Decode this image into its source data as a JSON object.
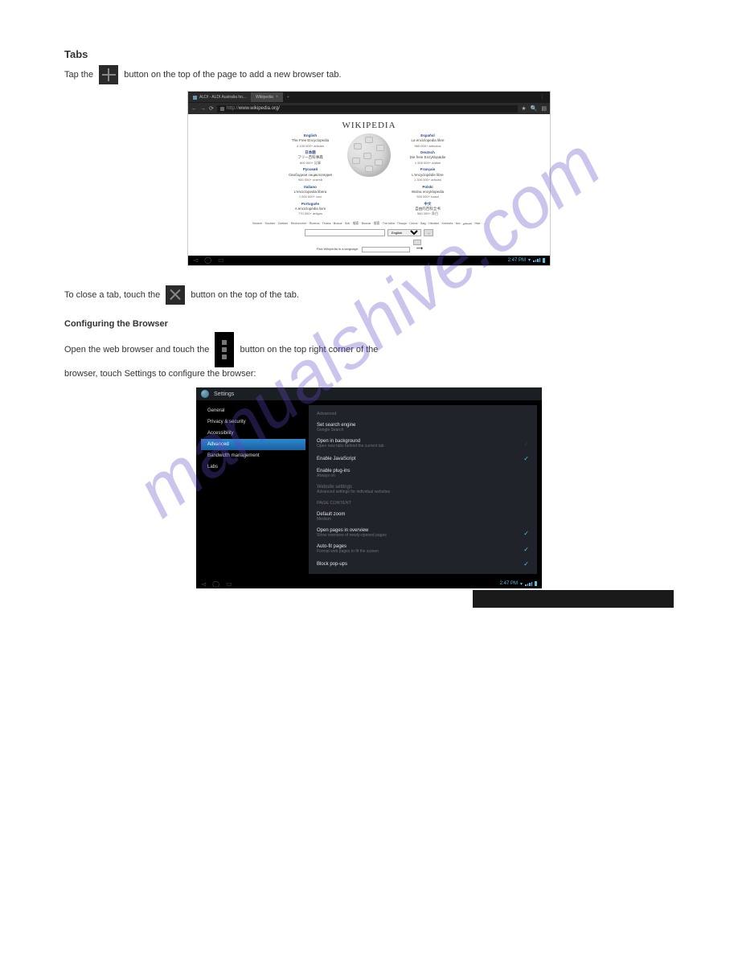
{
  "heading_main": "Tabs",
  "para1_before": "Tap the",
  "para1_after": "button on the top of the page to add a new browser tab.",
  "tab1_title": "ALDI - ALDI Australia ho...",
  "tab2_title": "Wikipedia",
  "url_prefix": "http://",
  "url_text": "www.wikipedia.org/",
  "wiki_title": "WIKIPEDIA",
  "langs_left": [
    {
      "name": "English",
      "sub": "The Free Encyclopedia",
      "count": "4 100 000+ articles"
    },
    {
      "name": "日本語",
      "sub": "フリー百科事典",
      "count": "800 000+ 記事"
    },
    {
      "name": "Русский",
      "sub": "Свободная энциклопедия",
      "count": "900 000+ статей"
    },
    {
      "name": "Italiano",
      "sub": "L'enciclopedia libera",
      "count": "1 000 000+ voci"
    },
    {
      "name": "Português",
      "sub": "A enciclopédia livre",
      "count": "770 000+ artigos"
    }
  ],
  "langs_right": [
    {
      "name": "Español",
      "sub": "La enciclopedia libre",
      "count": "960 000+ artículos"
    },
    {
      "name": "Deutsch",
      "sub": "Die freie Enzyklopädie",
      "count": "1 500 000+ Artikel"
    },
    {
      "name": "Français",
      "sub": "L'encyclopédie libre",
      "count": "1 300 000+ articles"
    },
    {
      "name": "Polski",
      "sub": "Wolna encyklopedia",
      "count": "900 000+ haseł"
    },
    {
      "name": "中文",
      "sub": "自由的百科全书",
      "count": "580 000+ 条目"
    }
  ],
  "wiki_langs_line": "Search · Suchen · Zoeken · Rechercher · Ricerca · Поиск · Busca · Sök · 検索 · Buscar · 搜索 · Tim kiếm · Пошук · Cerca · Søg · Hledání · Keresés · Ara · جستجو · Hae · ...",
  "wiki_search_lang": "English",
  "wiki_find_label": "Find Wikipedia in a language:",
  "clock": "2:47 PM",
  "para2_before": "To close a tab, touch the",
  "para2_after": "button on the top of the tab.",
  "config_heading": "Configuring the Browser",
  "config_line1_before": "Open the web browser and touch the",
  "config_line1_after": "button on the top right corner of the",
  "config_line2": "browser, touch Settings to configure the browser:",
  "settings_title": "Settings",
  "side_items": [
    "General",
    "Privacy & security",
    "Accessibility",
    "Advanced",
    "Bandwidth management",
    "Labs"
  ],
  "side_active_index": 3,
  "adv_header": "Advanced",
  "adv_rows": [
    {
      "t": "Set search engine",
      "s": "Google Search",
      "chk": null
    },
    {
      "t": "Open in background",
      "s": "Open new tabs behind the current tab",
      "chk": "off"
    },
    {
      "t": "Enable JavaScript",
      "s": "",
      "chk": "on"
    },
    {
      "t": "Enable plug-ins",
      "s": "Always on",
      "chk": null
    },
    {
      "t": "Website settings",
      "s": "Advanced settings for individual websites",
      "chk": null,
      "dim": true
    }
  ],
  "page_content_header": "PAGE CONTENT",
  "pc_rows": [
    {
      "t": "Default zoom",
      "s": "Medium",
      "chk": null
    },
    {
      "t": "Open pages in overview",
      "s": "Show overview of newly-opened pages",
      "chk": "on"
    },
    {
      "t": "Auto-fit pages",
      "s": "Format web pages to fit the screen",
      "chk": "on"
    },
    {
      "t": "Block pop-ups",
      "s": "",
      "chk": "on"
    }
  ],
  "watermark": "manualshive.com"
}
